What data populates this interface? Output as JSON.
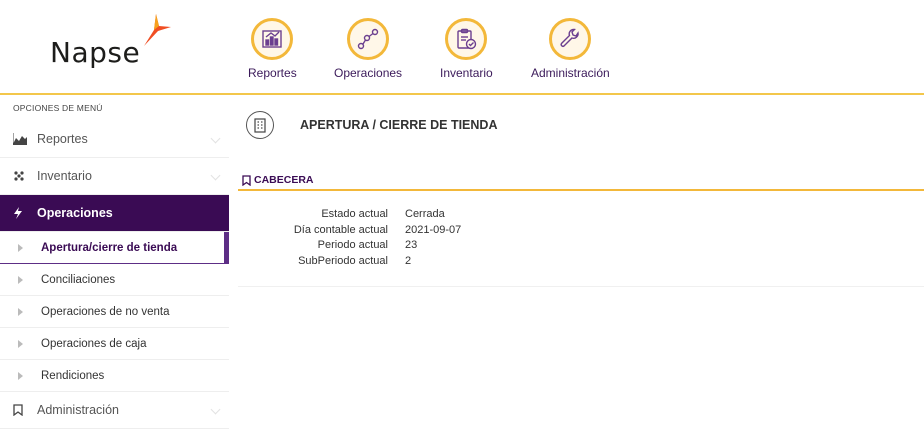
{
  "brand": {
    "name": "Napse",
    "accent": "#f3b83a",
    "primary": "#3a0b54"
  },
  "topnav": [
    {
      "label": "Reportes",
      "icon": "chart-icon"
    },
    {
      "label": "Operaciones",
      "icon": "nodes-icon"
    },
    {
      "label": "Inventario",
      "icon": "clipboard-check-icon"
    },
    {
      "label": "Administración",
      "icon": "wrench-icon"
    }
  ],
  "sidebar": {
    "title": "OPCIONES DE MENÚ",
    "items": [
      {
        "label": "Reportes",
        "icon": "area-chart-icon"
      },
      {
        "label": "Inventario",
        "icon": "dots-icon"
      },
      {
        "label": "Operaciones",
        "icon": "bolt-icon"
      },
      {
        "label": "Administración",
        "icon": "bookmark-icon"
      }
    ],
    "subitems": [
      {
        "label": "Apertura/cierre de tienda"
      },
      {
        "label": "Conciliaciones"
      },
      {
        "label": "Operaciones de no venta"
      },
      {
        "label": "Operaciones de caja"
      },
      {
        "label": "Rendiciones"
      }
    ]
  },
  "main": {
    "title": "APERTURA / CIERRE DE TIENDA",
    "section": "CABECERA",
    "fields": [
      {
        "label": "Estado actual",
        "value": "Cerrada"
      },
      {
        "label": "Día contable actual",
        "value": "2021-09-07"
      },
      {
        "label": "Periodo actual",
        "value": "23"
      },
      {
        "label": "SubPeriodo actual",
        "value": "2"
      }
    ]
  }
}
